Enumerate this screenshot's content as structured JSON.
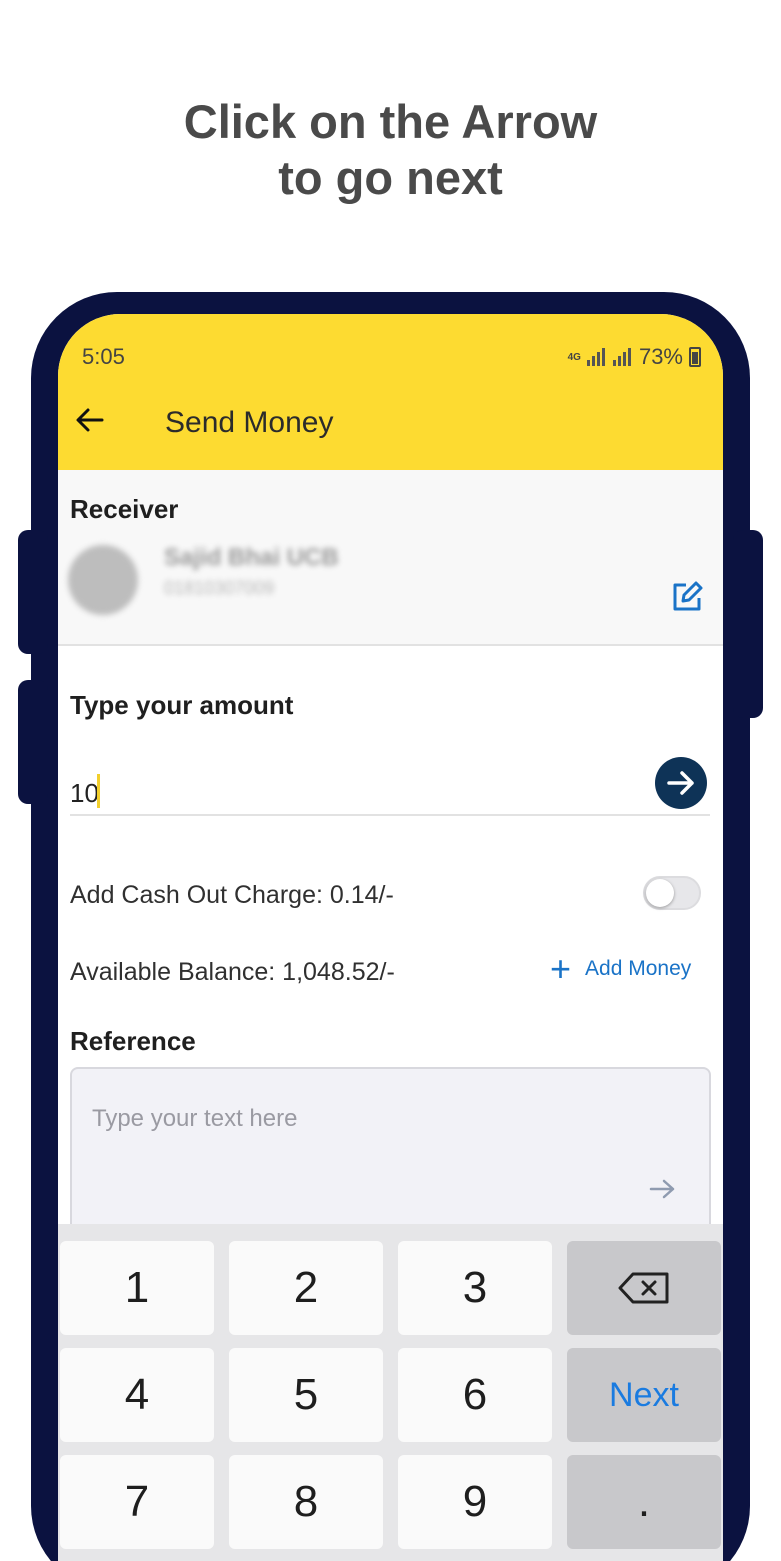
{
  "headline": {
    "line1": "Click on the Arrow",
    "line2": "to go next"
  },
  "status_bar": {
    "time": "5:05",
    "network": "4G",
    "battery": "73%"
  },
  "app_bar": {
    "title": "Send Money"
  },
  "receiver": {
    "label": "Receiver",
    "name": "Sajid Bhai UCB",
    "phone": "01810307009"
  },
  "amount": {
    "label": "Type your amount",
    "value": "10"
  },
  "cash_out": {
    "label": "Add Cash Out Charge:  0.14/-",
    "enabled": false
  },
  "balance": {
    "label": "Available Balance:  1,048.52/-",
    "add_money": "Add Money"
  },
  "reference": {
    "label": "Reference",
    "placeholder": "Type your text here"
  },
  "keypad": {
    "keys": [
      "1",
      "2",
      "3",
      "4",
      "5",
      "6",
      "7",
      "8",
      "9"
    ],
    "next": "Next",
    "dot": "."
  },
  "colors": {
    "header": "#fddb31",
    "frame": "#0b1240",
    "accent": "#1a73c7",
    "go_button": "#0e3357"
  },
  "icons": {
    "back": "arrow-left-icon",
    "edit": "edit-icon",
    "go": "arrow-right-circle-icon",
    "backspace": "backspace-icon",
    "plus": "plus-icon"
  }
}
